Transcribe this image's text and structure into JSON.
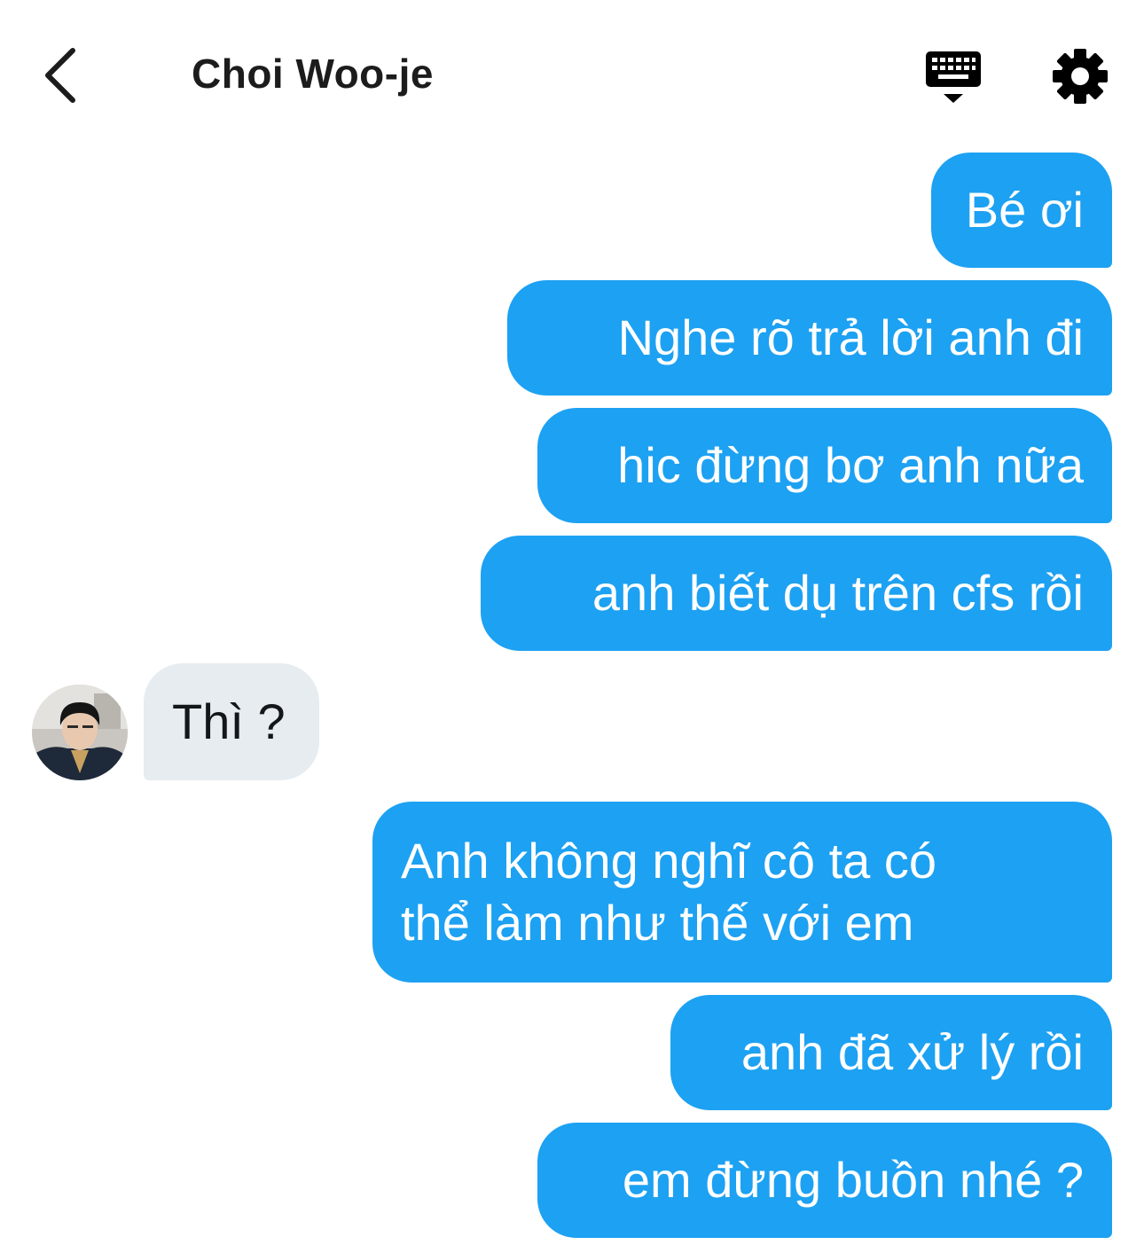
{
  "header": {
    "title": "Choi Woo-je",
    "back_icon": "chevron-left-icon",
    "keyboard_icon": "keyboard-icon",
    "settings_icon": "gear-icon"
  },
  "colors": {
    "outgoing_bubble": "#1da1f2",
    "incoming_bubble": "#e6ecf0",
    "text_dark": "#1c1c1c"
  },
  "messages": [
    {
      "direction": "outgoing",
      "text": "Bé ơi"
    },
    {
      "direction": "outgoing",
      "text": "Nghe rõ trả lời anh đi"
    },
    {
      "direction": "outgoing",
      "text": "hic đừng bơ anh nữa"
    },
    {
      "direction": "outgoing",
      "text": "anh biết dụ trên cfs rồi"
    },
    {
      "direction": "incoming",
      "text": "Thì ?"
    },
    {
      "direction": "outgoing",
      "lines": [
        "Anh không nghĩ cô ta có",
        "thể làm như thế với em"
      ]
    },
    {
      "direction": "outgoing",
      "text": "anh đã xử lý rồi"
    },
    {
      "direction": "outgoing",
      "text": "em đừng buồn nhé ?"
    }
  ]
}
